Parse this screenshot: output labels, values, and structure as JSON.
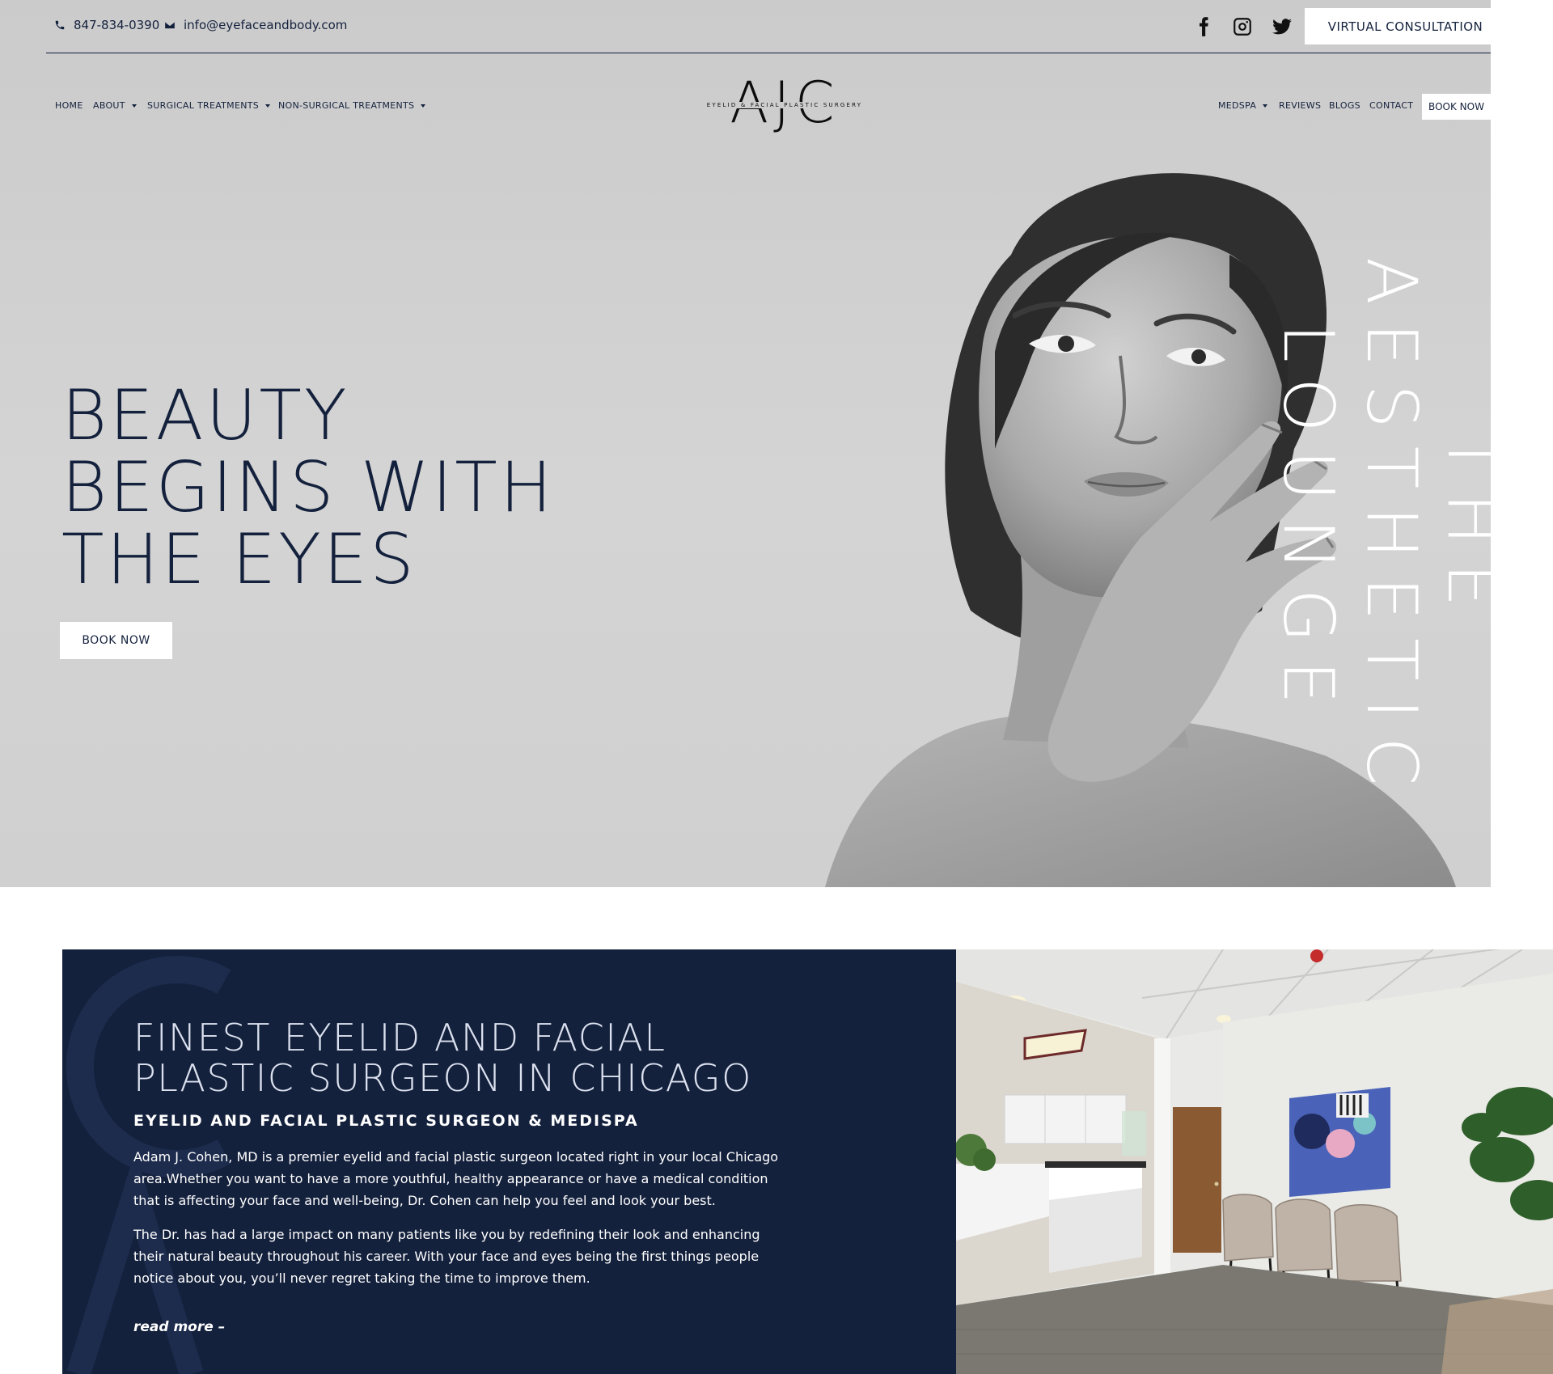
{
  "topbar": {
    "phone": "847-834-0390",
    "email": "info@eyefaceandbody.com",
    "social": [
      "facebook-icon",
      "instagram-icon",
      "twitter-icon"
    ],
    "cta": "VIRTUAL CONSULTATION"
  },
  "nav": {
    "left": [
      {
        "label": "HOME",
        "dropdown": false
      },
      {
        "label": "ABOUT",
        "dropdown": true
      },
      {
        "label": "SURGICAL TREATMENTS",
        "dropdown": true
      },
      {
        "label": "NON-SURGICAL TREATMENTS",
        "dropdown": true
      }
    ],
    "right": [
      {
        "label": "MEDSPA",
        "dropdown": true
      },
      {
        "label": "REVIEWS",
        "dropdown": false
      },
      {
        "label": "BLOGS",
        "dropdown": false
      },
      {
        "label": "CONTACT",
        "dropdown": false
      }
    ],
    "book": "BOOK NOW"
  },
  "logo": {
    "letters": "AJC",
    "subtitle": "EYELID & FACIAL PLASTIC SURGERY"
  },
  "hero": {
    "headline": [
      "BEAUTY",
      "BEGINS WITH",
      "THE EYES"
    ],
    "button": "BOOK NOW",
    "vertical": [
      "THE",
      "AESTHETIC",
      "LOUNGE"
    ]
  },
  "about": {
    "title": [
      "FINEST EYELID AND FACIAL",
      "PLASTIC SURGEON IN CHICAGO"
    ],
    "subtitle": "EYELID AND FACIAL PLASTIC SURGEON & MEDISPA",
    "p1": "Adam J. Cohen, MD is a premier eyelid and facial plastic surgeon located right in your local Chicago area.Whether you want to have a more youthful, healthy appearance or have a medical condition that is affecting your face and well-being, Dr. Cohen can help you feel and look your best.",
    "p2": "The Dr. has had a large impact on many patients like you by redefining their look and enhancing their natural beauty throughout his career. With your face and eyes being the first things people notice about you, you’ll never regret taking the time to improve them.",
    "read_more": "read more –"
  },
  "colors": {
    "navy": "#14213d",
    "hero_bg": "#d0d0d0",
    "white": "#ffffff"
  }
}
